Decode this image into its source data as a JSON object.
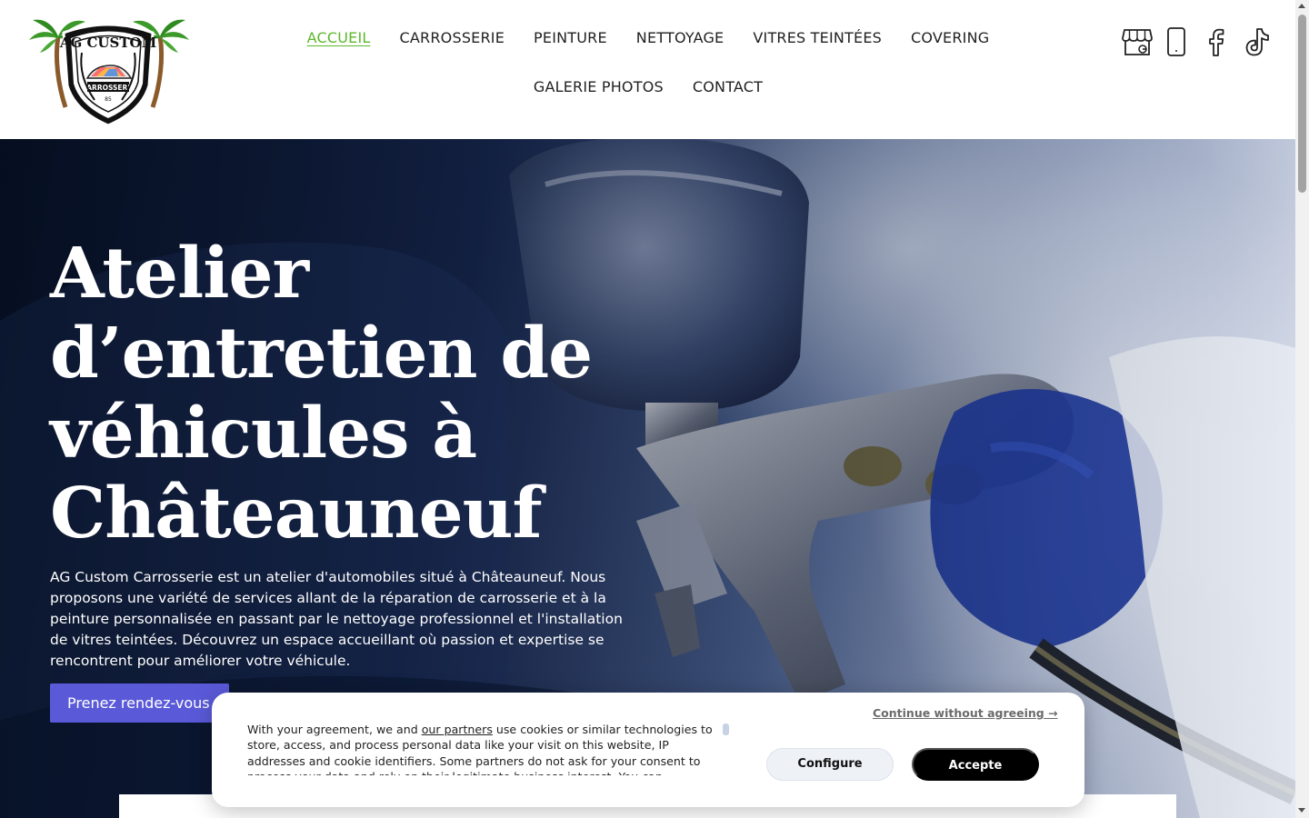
{
  "header": {
    "logo": {
      "top_text": "AG CUSTOM",
      "ribbon_text": "CARROSSERIE",
      "small_text": "85"
    },
    "nav": [
      {
        "label": "ACCUEIL",
        "active": true
      },
      {
        "label": "CARROSSERIE"
      },
      {
        "label": "PEINTURE"
      },
      {
        "label": "NETTOYAGE"
      },
      {
        "label": "VITRES TEINTÉES"
      },
      {
        "label": "COVERING"
      },
      {
        "label": "GALERIE PHOTOS"
      },
      {
        "label": "CONTACT"
      }
    ],
    "social_icons": [
      "google-business-icon",
      "phone-icon",
      "facebook-icon",
      "tiktok-icon"
    ]
  },
  "hero": {
    "title": "Atelier d’entretien de véhicules à Châteauneuf",
    "description": "AG Custom Carrosserie est un atelier d'automobiles situé à Châteauneuf. Nous proposons une variété de services allant de la réparation de carrosserie et à la peinture personnalisée en passant par le nettoyage professionnel et l'installation de vitres teintées. Découvrez un espace accueillant où passion et expertise se rencontrent pour améliorer votre véhicule.",
    "cta_label": "Prenez rendez-vous"
  },
  "cookie_banner": {
    "text_before": "With your agreement, we and ",
    "partners_link": "our partners",
    "text_after": " use cookies or similar technologies to store, access, and process personal data like your visit on this website, IP addresses and cookie identifiers. Some partners do not ask for your consent to process your data and rely on their legitimate business interest. You can",
    "continue_label": "Continue without agreeing →",
    "configure_label": "Configure",
    "accept_label": "Accepte"
  },
  "colors": {
    "nav_active": "#5cb82a",
    "cta": "#5a5ad9",
    "accept_button": "#000000",
    "configure_button": "#eef1f6"
  }
}
